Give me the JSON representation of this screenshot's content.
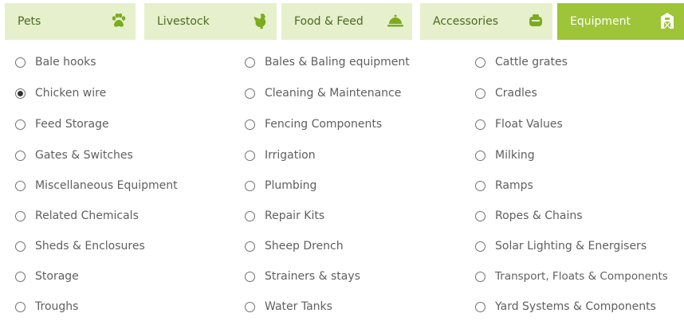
{
  "tabs": [
    {
      "label": "Pets",
      "icon": "paw-icon",
      "active": false
    },
    {
      "label": "Livestock",
      "icon": "chicken-icon",
      "active": false
    },
    {
      "label": "Food & Feed",
      "icon": "food-dome-icon",
      "active": false
    },
    {
      "label": "Accessories",
      "icon": "accessory-icon",
      "active": false
    },
    {
      "label": "Equipment",
      "icon": "barn-icon",
      "active": true
    }
  ],
  "columns": [
    [
      {
        "label": "Bale hooks",
        "checked": false
      },
      {
        "label": "Chicken wire",
        "checked": true
      },
      {
        "label": "Feed Storage",
        "checked": false
      },
      {
        "label": "Gates & Switches",
        "checked": false
      },
      {
        "label": "Miscellaneous Equipment",
        "checked": false
      },
      {
        "label": "Related Chemicals",
        "checked": false
      },
      {
        "label": "Sheds & Enclosures",
        "checked": false
      },
      {
        "label": "Storage",
        "checked": false
      },
      {
        "label": "Troughs",
        "checked": false
      }
    ],
    [
      {
        "label": "Bales & Baling equipment",
        "checked": false
      },
      {
        "label": "Cleaning & Maintenance",
        "checked": false
      },
      {
        "label": "Fencing Components",
        "checked": false
      },
      {
        "label": "Irrigation",
        "checked": false
      },
      {
        "label": "Plumbing",
        "checked": false
      },
      {
        "label": "Repair Kits",
        "checked": false
      },
      {
        "label": "Sheep Drench",
        "checked": false
      },
      {
        "label": "Strainers & stays",
        "checked": false
      },
      {
        "label": "Water Tanks",
        "checked": false
      }
    ],
    [
      {
        "label": "Cattle grates",
        "checked": false
      },
      {
        "label": "Cradles",
        "checked": false
      },
      {
        "label": "Float Values",
        "checked": false
      },
      {
        "label": "Milking",
        "checked": false
      },
      {
        "label": "Ramps",
        "checked": false
      },
      {
        "label": "Ropes & Chains",
        "checked": false
      },
      {
        "label": "Solar Lighting & Energisers",
        "checked": false
      },
      {
        "label": "Transport, Floats & Components",
        "checked": false
      },
      {
        "label": "Yard Systems & Components",
        "checked": false
      }
    ]
  ],
  "colors": {
    "tab_bg": "#e6f0cc",
    "tab_active_bg": "#9ec437",
    "tab_text": "#4b6a22",
    "icon": "#7cab1f"
  }
}
